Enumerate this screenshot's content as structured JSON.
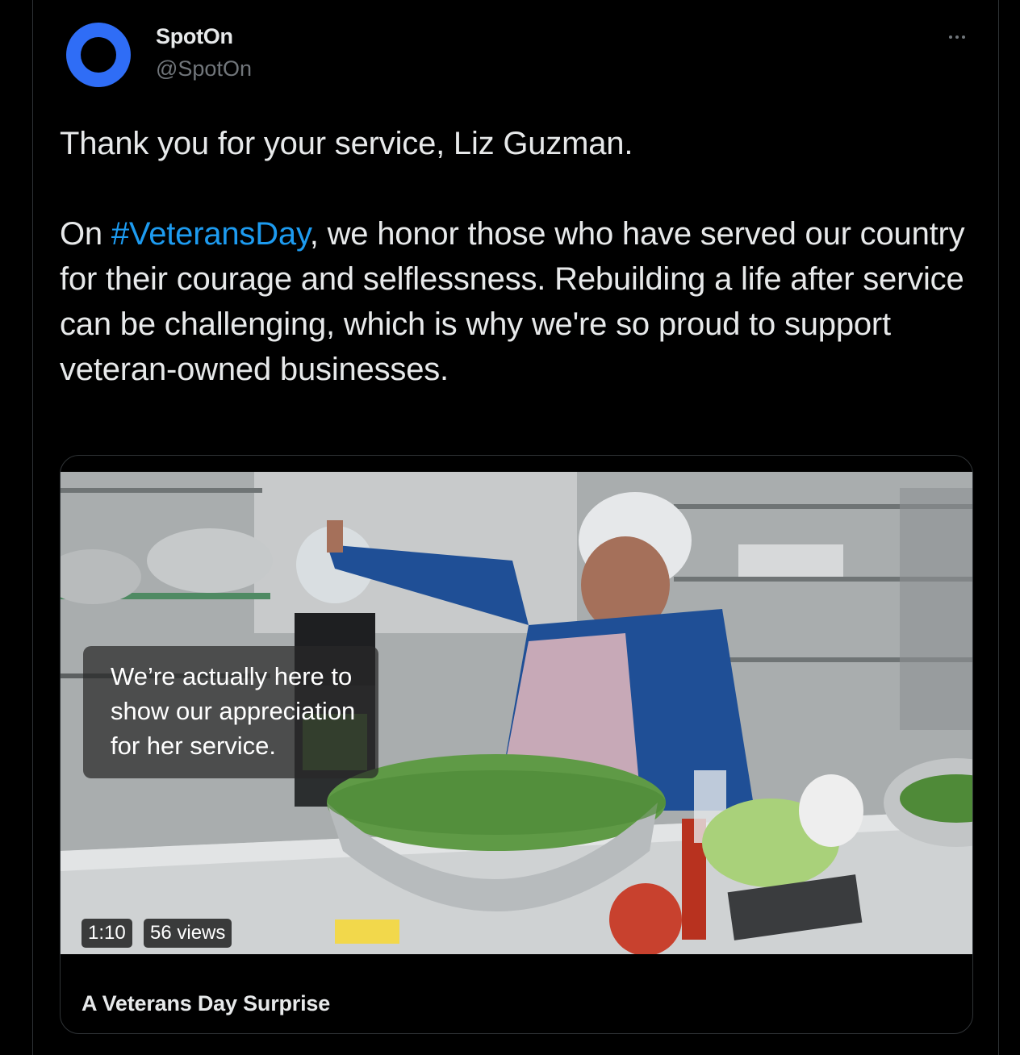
{
  "author": {
    "display_name": "SpotOn",
    "handle": "@SpotOn",
    "avatar_icon": "spoton-logo-icon",
    "avatar_color": "#2f6df6"
  },
  "tweet": {
    "line1": "Thank you for your service, Liz Guzman.",
    "line2_prefix": "On ",
    "hashtag": "#VeteransDay",
    "line2_suffix": ", we honor those who have served our country for their courage and selflessness. Rebuilding a life after service can be challenging, which is why we're so proud to support veteran-owned businesses."
  },
  "media_card": {
    "caption_lines": [
      "We’re actually here to",
      "show our appreciation",
      "for her service."
    ],
    "duration": "1:10",
    "views": "56 views",
    "title": "A Veterans Day Surprise"
  },
  "colors": {
    "background": "#000000",
    "text": "#e7e9ea",
    "secondary": "#71767b",
    "link": "#1d9bf0",
    "border": "#2f3336"
  }
}
